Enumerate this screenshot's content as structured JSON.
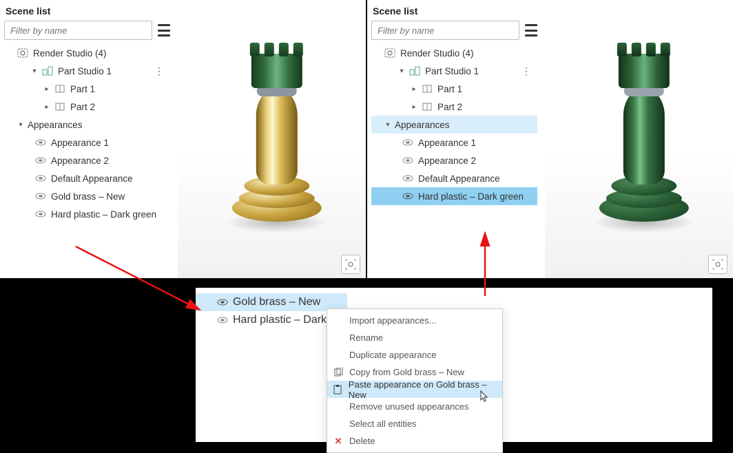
{
  "left": {
    "title": "Scene list",
    "filter_placeholder": "Filter by name",
    "root": "Render Studio (4)",
    "studio": "Part Studio 1",
    "part1": "Part 1",
    "part2": "Part 2",
    "appearances_label": "Appearances",
    "app1": "Appearance 1",
    "app2": "Appearance 2",
    "def": "Default Appearance",
    "gold": "Gold brass – New",
    "plastic": "Hard plastic – Dark green"
  },
  "right": {
    "title": "Scene list",
    "filter_placeholder": "Filter by name",
    "root": "Render Studio (4)",
    "studio": "Part Studio 1",
    "part1": "Part 1",
    "part2": "Part 2",
    "appearances_label": "Appearances",
    "app1": "Appearance 1",
    "app2": "Appearance 2",
    "def": "Default Appearance",
    "plastic": "Hard plastic – Dark green"
  },
  "ctx": {
    "gold": "Gold brass – New",
    "plastic_trunc": "Hard plastic – Dark"
  },
  "menu": {
    "import": "Import appearances...",
    "rename": "Rename",
    "duplicate": "Duplicate appearance",
    "copy": "Copy from Gold brass – New",
    "paste": "Paste appearance on Gold brass – New",
    "remove": "Remove unused appearances",
    "select_all": "Select all entities",
    "delete": "Delete"
  }
}
